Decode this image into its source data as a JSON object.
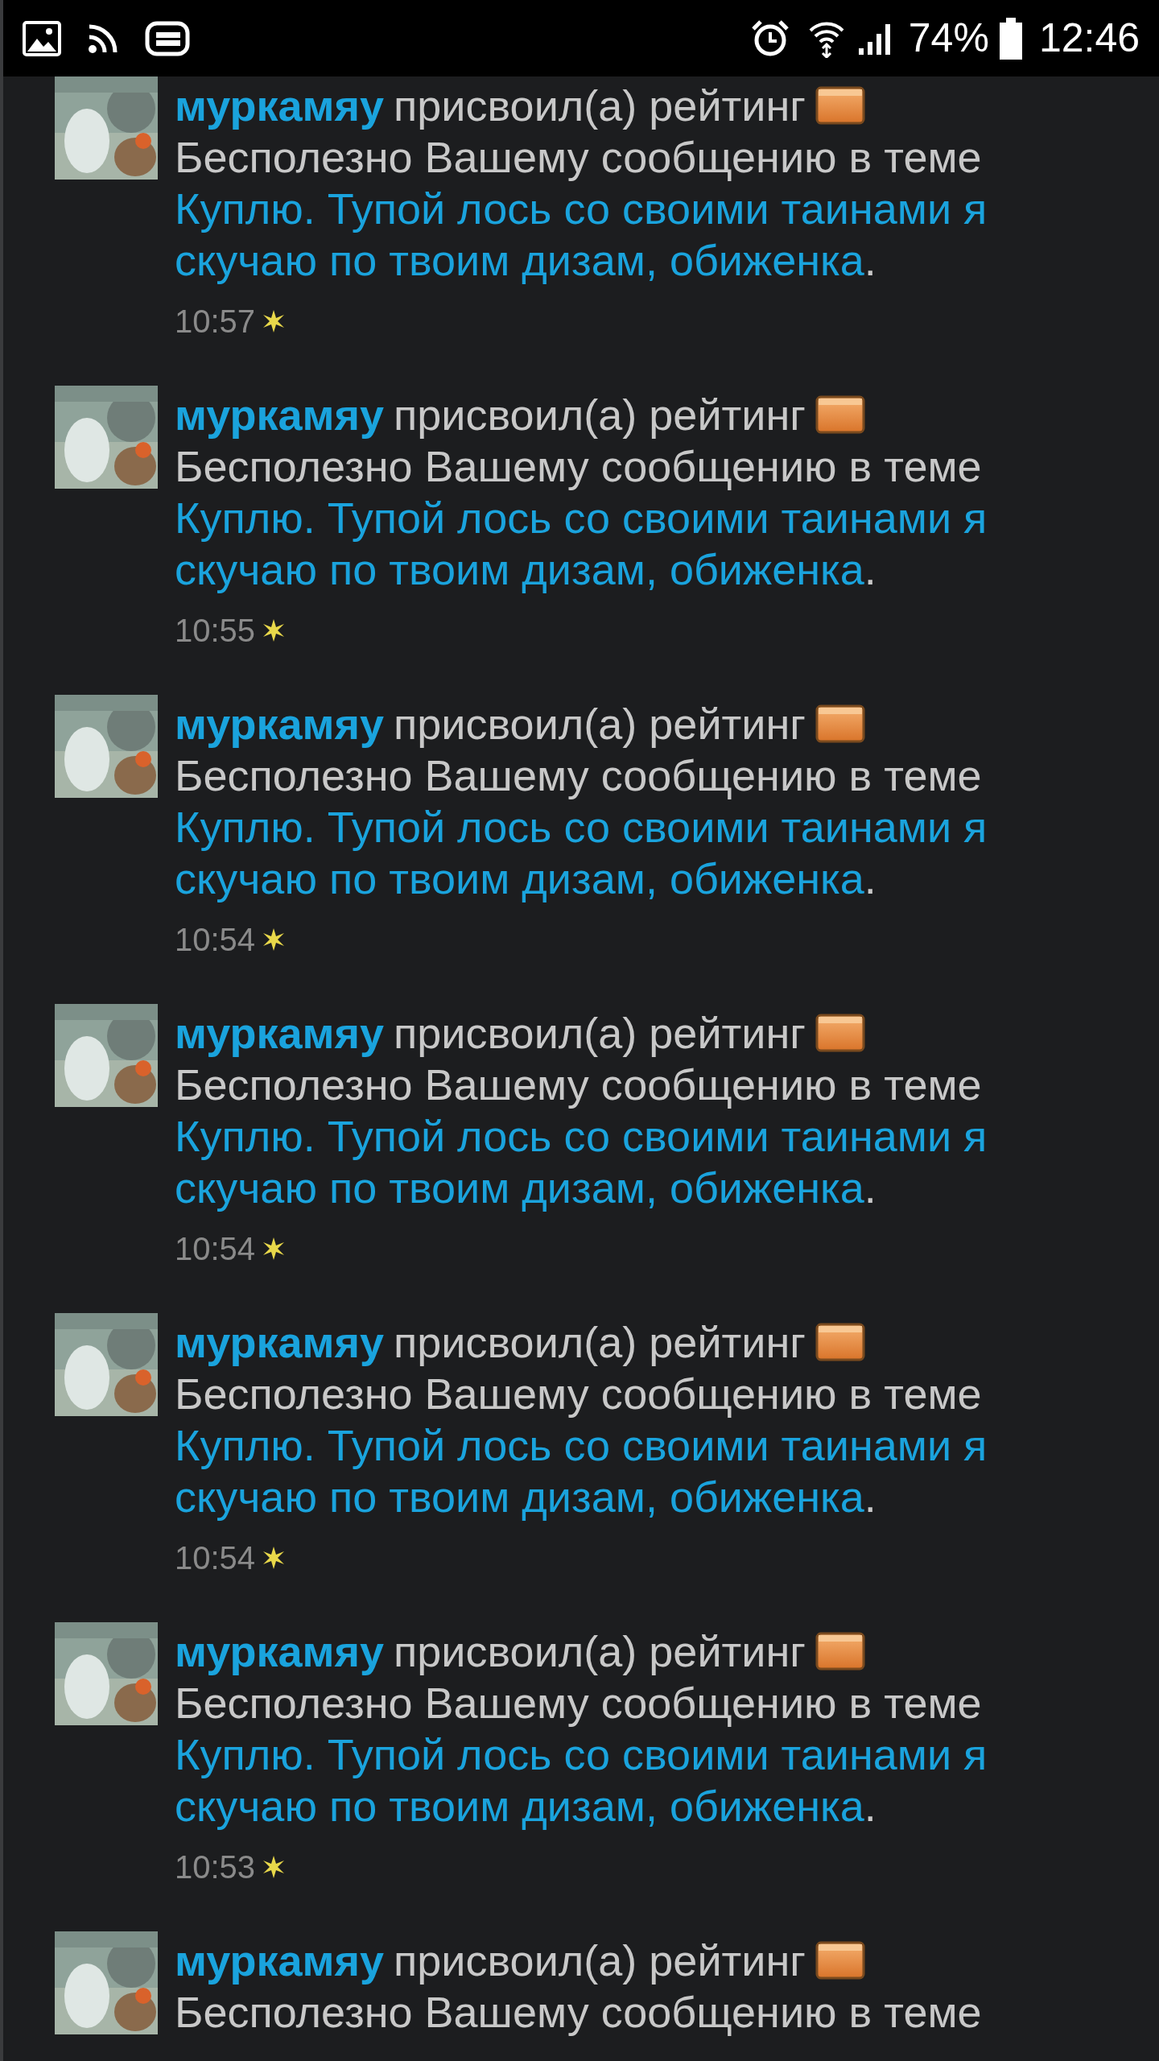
{
  "status_bar": {
    "battery": "74%",
    "time": "12:46"
  },
  "notifications": [
    {
      "user": "муркамяу",
      "action": "присвоил(а) рейтинг",
      "preamble": "Бесполезно Вашему сообщению в теме",
      "topic": "Куплю. Тупой лось со своими таинами я скучаю по твоим дизам, обиженка",
      "punct": ".",
      "time": "10:57"
    },
    {
      "user": "муркамяу",
      "action": "присвоил(а) рейтинг",
      "preamble": "Бесполезно Вашему сообщению в теме",
      "topic": "Куплю. Тупой лось со своими таинами я скучаю по твоим дизам, обиженка",
      "punct": ".",
      "time": "10:55"
    },
    {
      "user": "муркамяу",
      "action": "присвоил(а) рейтинг",
      "preamble": "Бесполезно Вашему сообщению в теме",
      "topic": "Куплю. Тупой лось со своими таинами я скучаю по твоим дизам, обиженка",
      "punct": ".",
      "time": "10:54"
    },
    {
      "user": "муркамяу",
      "action": "присвоил(а) рейтинг",
      "preamble": "Бесполезно Вашему сообщению в теме",
      "topic": "Куплю. Тупой лось со своими таинами я скучаю по твоим дизам, обиженка",
      "punct": ".",
      "time": "10:54"
    },
    {
      "user": "муркамяу",
      "action": "присвоил(а) рейтинг",
      "preamble": "Бесполезно Вашему сообщению в теме",
      "topic": "Куплю. Тупой лось со своими таинами я скучаю по твоим дизам, обиженка",
      "punct": ".",
      "time": "10:54"
    },
    {
      "user": "муркамяу",
      "action": "присвоил(а) рейтинг",
      "preamble": "Бесполезно Вашему сообщению в теме",
      "topic": "Куплю. Тупой лось со своими таинами я скучаю по твоим дизам, обиженка",
      "punct": ".",
      "time": "10:53"
    },
    {
      "user": "муркамяу",
      "action": "присвоил(а) рейтинг",
      "preamble": "Бесполезно Вашему сообщению в теме"
    }
  ]
}
